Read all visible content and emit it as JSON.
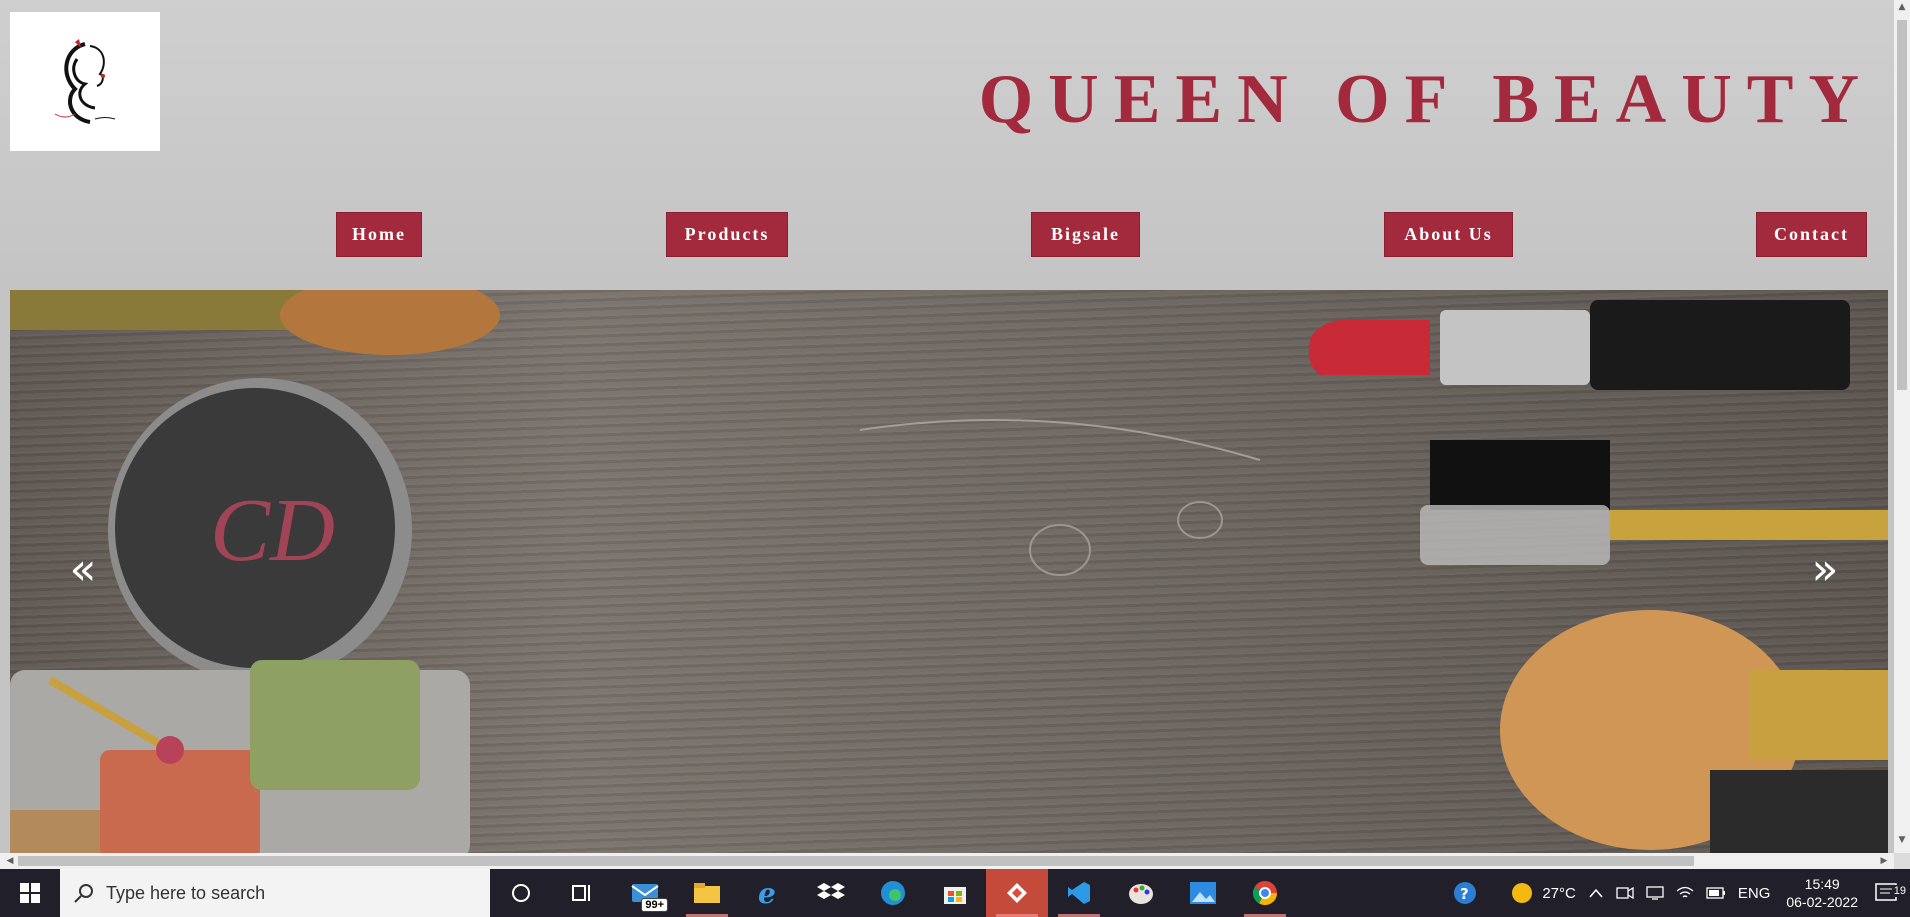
{
  "site": {
    "title": "QUEEN OF BEAUTY",
    "logo_alt_icon": "beauty-face-logo",
    "brand_color": "#a3293c"
  },
  "nav": {
    "items": [
      {
        "label": "Home"
      },
      {
        "label": "Products"
      },
      {
        "label": "Bigsale"
      },
      {
        "label": "About Us"
      },
      {
        "label": "Contact"
      }
    ]
  },
  "hero": {
    "prev_symbol": "«",
    "next_symbol": "»",
    "image": "cosmetics-on-wood-slide"
  },
  "taskbar": {
    "search_placeholder": "Type here to search",
    "mail_badge": "99+",
    "weather_temp": "27°C",
    "language": "ENG",
    "time": "15:49",
    "date": "06-02-2022",
    "notifications": "19"
  }
}
